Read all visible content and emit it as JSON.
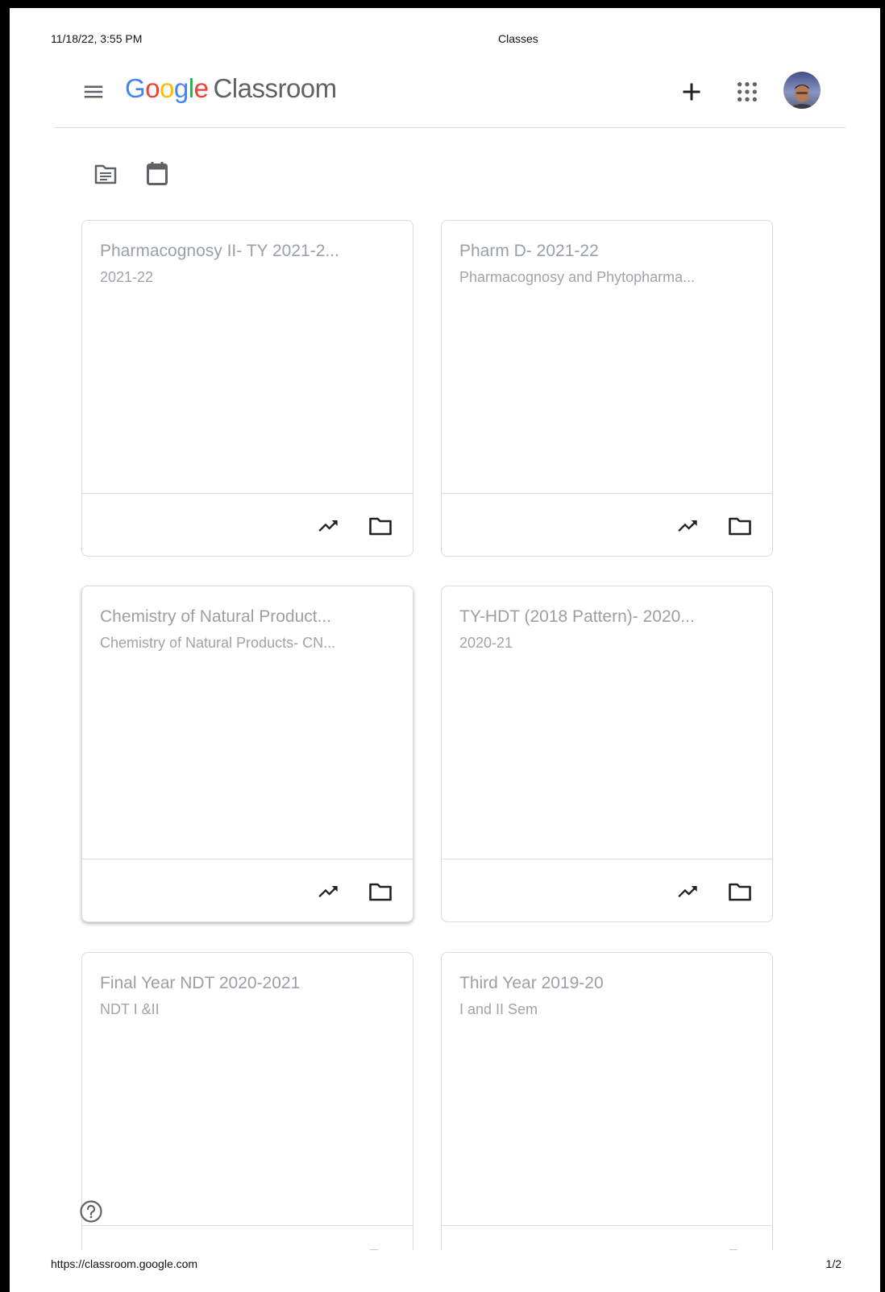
{
  "print_header": {
    "datetime": "11/18/22, 3:55 PM",
    "title": "Classes"
  },
  "app_bar": {
    "logo": {
      "letters": [
        "G",
        "o",
        "o",
        "g",
        "l",
        "e"
      ],
      "product": "Classroom"
    },
    "icons": [
      "menu-icon",
      "plus-icon",
      "apps-grid-icon",
      "avatar"
    ]
  },
  "toolbar": {
    "icons": [
      "to-review-icon",
      "calendar-icon"
    ]
  },
  "classes": [
    {
      "title": "Pharmacognosy II- TY 2021-2...",
      "subtitle": "2021-22"
    },
    {
      "title": "Pharm D- 2021-22",
      "subtitle": "Pharmacognosy and Phytopharma..."
    },
    {
      "title": "Chemistry of Natural Product...",
      "subtitle": "Chemistry of Natural Products- CN..."
    },
    {
      "title": "TY-HDT (2018 Pattern)- 2020...",
      "subtitle": "2020-21"
    },
    {
      "title": "Final Year NDT 2020-2021",
      "subtitle": "NDT I &II"
    },
    {
      "title": "Third Year 2019-20",
      "subtitle": "I and II Sem"
    }
  ],
  "card_actions": [
    "trending-up-icon",
    "folder-icon"
  ],
  "print_footer": {
    "url": "https://classroom.google.com",
    "page": "1/2"
  },
  "colors": {
    "google_blue": "#4285f4",
    "google_red": "#ea4335",
    "google_yellow": "#fbbc05",
    "google_green": "#34a853",
    "text_grey": "#5f6368",
    "divider": "#dadce0"
  }
}
